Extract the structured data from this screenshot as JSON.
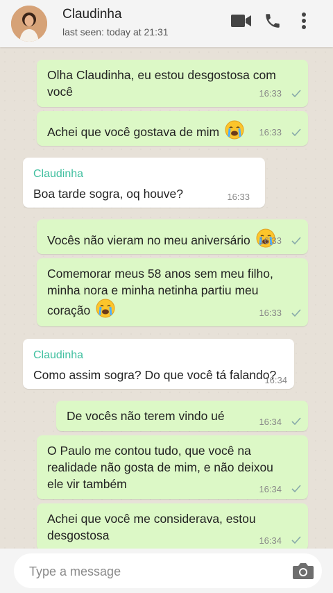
{
  "header": {
    "contact_name": "Claudinha",
    "last_seen": "last seen: today at 21:31",
    "icons": [
      "video-call-icon",
      "phone-call-icon",
      "more-options-icon"
    ]
  },
  "messages": [
    {
      "direction": "out",
      "text_lines": [
        "Olha Claudinha, eu estou desgostosa com",
        "você"
      ],
      "time": "16:33",
      "status": "sent-check"
    },
    {
      "direction": "out",
      "text_lines": [
        "Achei que você gostava de mim"
      ],
      "emoji": "crying-face",
      "time": "16:33",
      "status": "sent-check"
    },
    {
      "direction": "in",
      "sender": "Claudinha",
      "text_lines": [
        "Boa tarde sogra, oq houve?"
      ],
      "time": "16:33"
    },
    {
      "direction": "out",
      "text_lines": [
        "Vocês não vieram no meu aniversário"
      ],
      "emoji": "crying-face",
      "time": "16:33",
      "status": "sent-check"
    },
    {
      "direction": "out",
      "text_lines": [
        "Comemorar meus 58 anos sem meu filho,",
        "minha nora e minha netinha partiu meu",
        "coração"
      ],
      "emoji": "crying-face",
      "time": "16:33",
      "status": "sent-check"
    },
    {
      "direction": "in",
      "sender": "Claudinha",
      "text_lines": [
        "Como assim sogra? Do que você tá falando?"
      ],
      "time": "16:34"
    },
    {
      "direction": "out",
      "text_lines": [
        "De vocês não terem vindo ué"
      ],
      "time": "16:34",
      "status": "sent-check"
    },
    {
      "direction": "out",
      "text_lines": [
        "O Paulo me contou tudo, que você na",
        "realidade não gosta de mim, e não deixou",
        "ele vir também"
      ],
      "time": "16:34",
      "status": "sent-check"
    },
    {
      "direction": "out",
      "text_lines": [
        "Achei que você me considerava, estou",
        "desgostosa"
      ],
      "time": "16:34",
      "status": "sent-check"
    }
  ],
  "composer": {
    "placeholder": "Type a message",
    "value": "",
    "icon": "camera-icon"
  },
  "colors": {
    "outgoing_bubble": "#dcf8c6",
    "incoming_bubble": "#ffffff",
    "sender_name": "#3fbf9f",
    "chat_background": "#e7e1d8"
  }
}
